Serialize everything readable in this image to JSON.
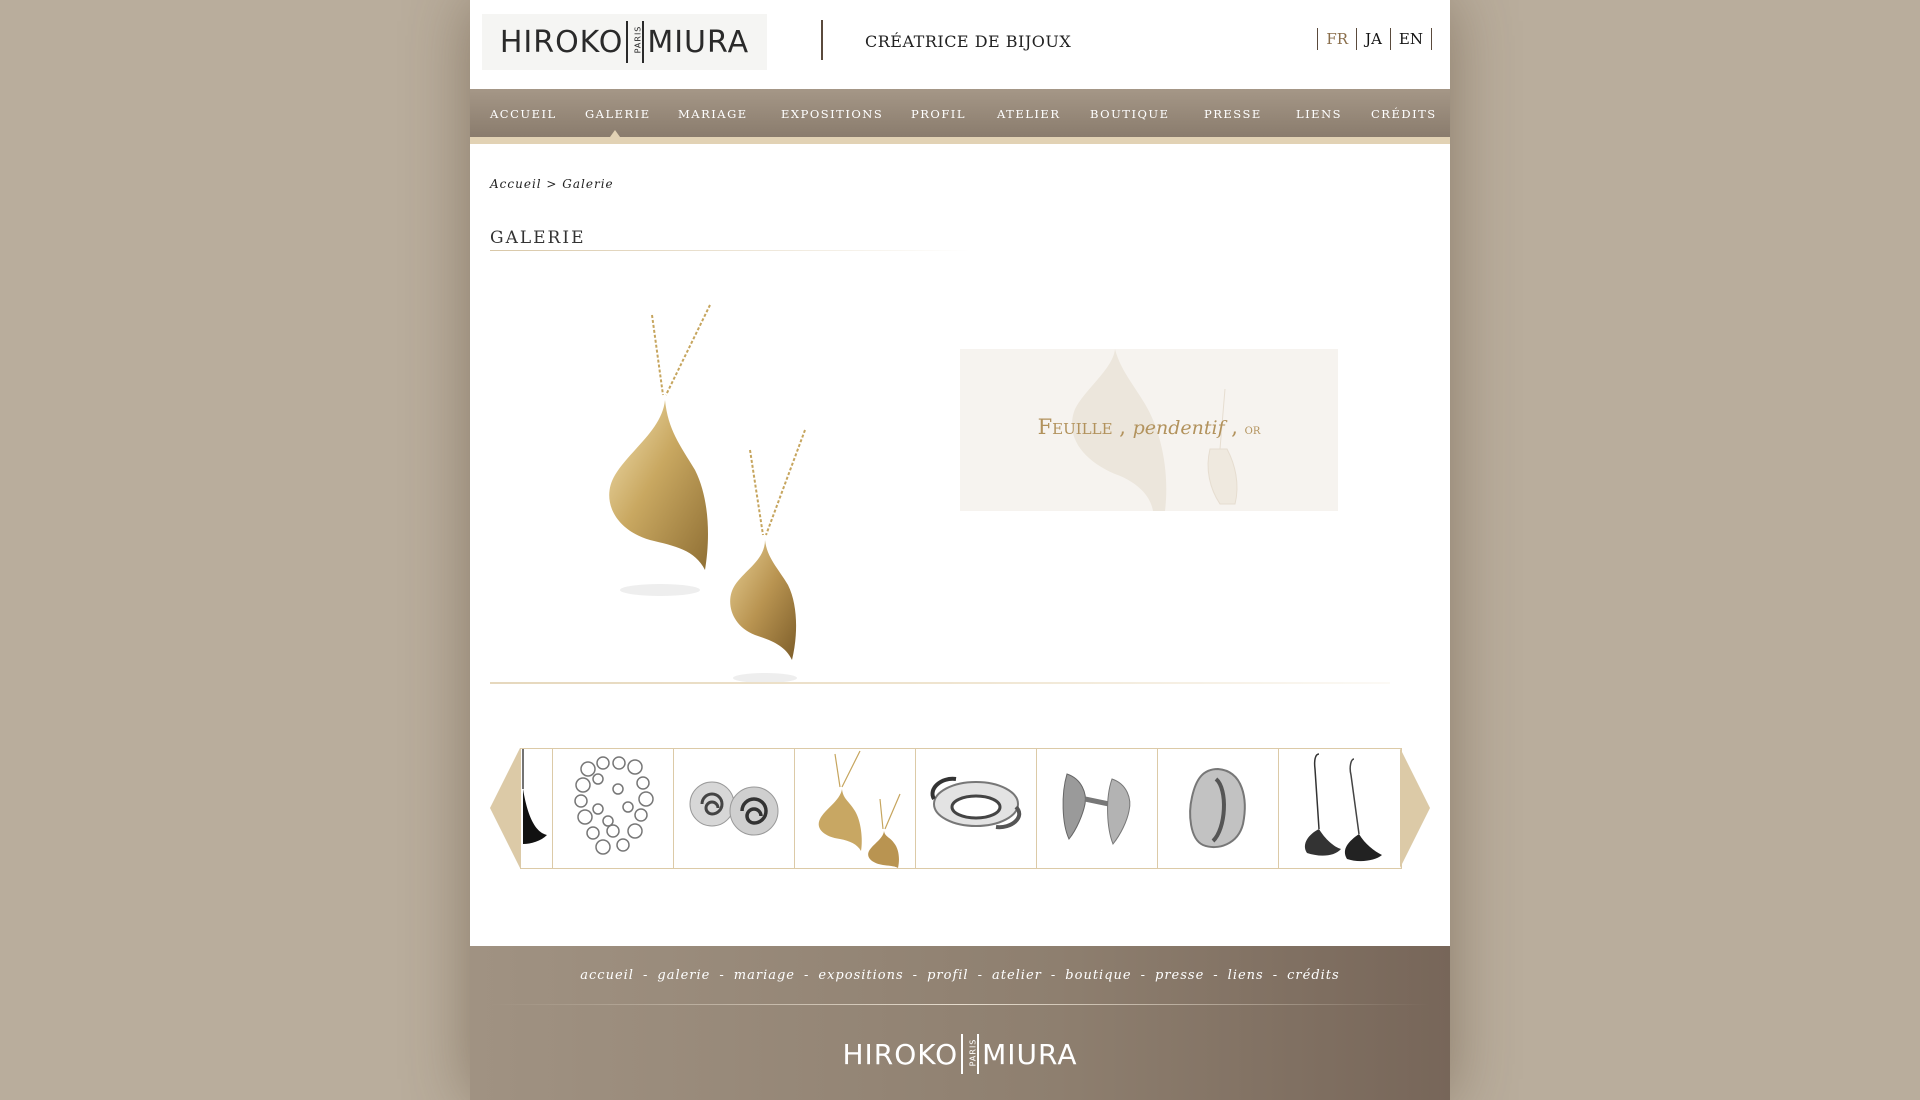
{
  "header": {
    "logo_left": "HIROKO",
    "logo_center": "PARIS",
    "logo_right": "MIURA",
    "tagline": "CRÉATRICE DE BIJOUX",
    "languages": [
      {
        "label": "FR",
        "active": true
      },
      {
        "label": "JA",
        "active": false
      },
      {
        "label": "EN",
        "active": false
      }
    ]
  },
  "nav": {
    "items": [
      {
        "label": "ACCUEIL"
      },
      {
        "label": "GALERIE",
        "active": true
      },
      {
        "label": "MARIAGE"
      },
      {
        "label": "EXPOSITIONS"
      },
      {
        "label": "PROFIL"
      },
      {
        "label": "ATELIER"
      },
      {
        "label": "BOUTIQUE"
      },
      {
        "label": "PRESSE"
      },
      {
        "label": "LIENS"
      },
      {
        "label": "CRÉDITS"
      }
    ]
  },
  "breadcrumb": {
    "text": "Accueil > Galerie"
  },
  "gallery": {
    "title": "GALERIE",
    "caption": {
      "name": "Feuille",
      "sep1": " , ",
      "type": "pendentif",
      "sep2": " , ",
      "material": "or"
    },
    "thumbnails": [
      {
        "icon": "black-earring-partial-thumb"
      },
      {
        "icon": "silver-chain-necklace-thumb"
      },
      {
        "icon": "silver-spiral-earrings-thumb"
      },
      {
        "icon": "gold-leaf-pendants-thumb"
      },
      {
        "icon": "silver-ring-thumb"
      },
      {
        "icon": "silver-cufflinks-thumb"
      },
      {
        "icon": "silver-ring-round-thumb"
      },
      {
        "icon": "dark-drop-earrings-thumb"
      }
    ]
  },
  "footer": {
    "links": [
      "accueil",
      "galerie",
      "mariage",
      "expositions",
      "profil",
      "atelier",
      "boutique",
      "presse",
      "liens",
      "crédits"
    ],
    "separator": "-",
    "logo_left": "HIROKO",
    "logo_center": "PARIS",
    "logo_right": "MIURA"
  },
  "colors": {
    "background": "#b9ad9c",
    "nav": "#9a8c7c",
    "accent_gold": "#b2925c",
    "border_beige": "#dccaa7"
  }
}
